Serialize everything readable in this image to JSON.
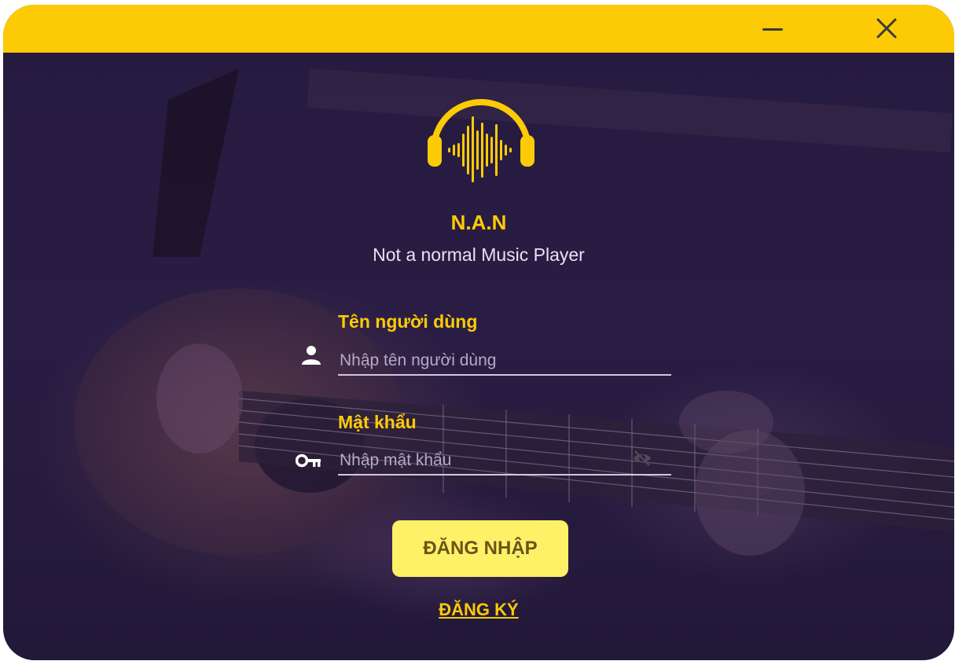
{
  "window": {
    "controls": {
      "minimize_icon": "minimize-icon",
      "close_icon": "close-icon"
    },
    "accent_color": "#fccb06"
  },
  "brand": {
    "logo_icon": "headphones-soundwave-icon",
    "title": "N.A.N",
    "subtitle": "Not a normal Music Player"
  },
  "form": {
    "username": {
      "label": "Tên người dùng",
      "placeholder": "Nhập tên người dùng",
      "value": "",
      "icon": "user-icon"
    },
    "password": {
      "label": "Mật khẩu",
      "placeholder": "Nhập mật khẩu",
      "value": "",
      "icon": "key-icon",
      "toggle_icon": "eye-off-icon"
    },
    "login_label": "ĐĂNG NHẬP",
    "register_label": "ĐĂNG KÝ"
  },
  "colors": {
    "titlebar": "#fccb06",
    "background": "#251a3f",
    "button": "#fdf168",
    "button_text": "#6a5418"
  }
}
